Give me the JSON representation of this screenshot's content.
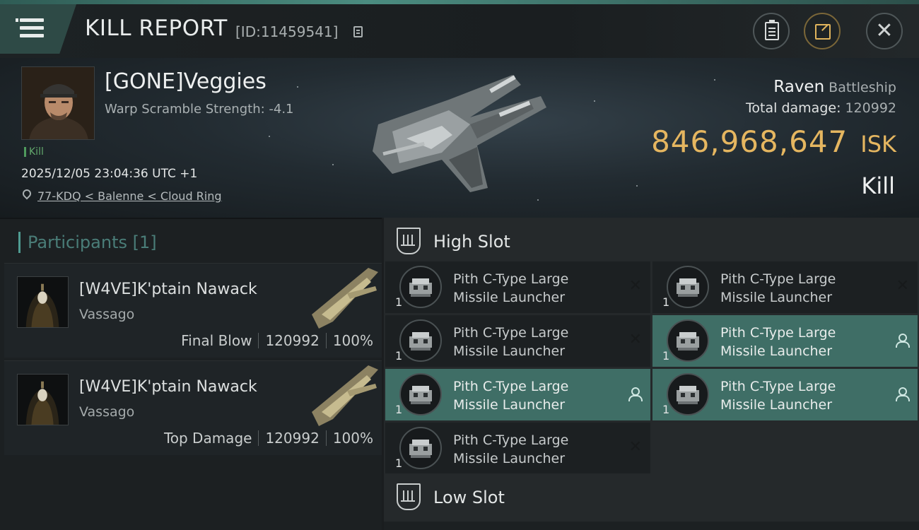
{
  "titlebar": {
    "title": "KILL REPORT",
    "report_id": "[ID:11459541]"
  },
  "victim": {
    "name": "[GONE]Veggies",
    "warp_scramble": "Warp Scramble Strength: -4.1",
    "kill_tag": "Kill",
    "timestamp": "2025/12/05 23:04:36 UTC +1",
    "location": "77-KDQ < Balenne < Cloud Ring",
    "ship_name": "Raven",
    "ship_class": "Battleship",
    "total_damage_label": "Total damage:",
    "total_damage_value": "120992",
    "isk_value": "846,968,647",
    "isk_unit": "ISK",
    "kill_type": "Kill"
  },
  "participants": {
    "label": "Participants",
    "count": "[1]",
    "rows": [
      {
        "name": "[W4VE]K'ptain Nawack",
        "ship": "Vassago",
        "role": "Final Blow",
        "damage": "120992",
        "percent": "100%"
      },
      {
        "name": "[W4VE]K'ptain Nawack",
        "ship": "Vassago",
        "role": "Top Damage",
        "damage": "120992",
        "percent": "100%"
      }
    ]
  },
  "modules": {
    "high_slot_label": "High Slot",
    "low_slot_label": "Low Slot",
    "high_items": [
      {
        "line1": "Pith C-Type Large",
        "line2": "Missile Launcher",
        "qty": "1",
        "status": "destroyed"
      },
      {
        "line1": "Pith C-Type Large",
        "line2": "Missile Launcher",
        "qty": "1",
        "status": "destroyed"
      },
      {
        "line1": "Pith C-Type Large",
        "line2": "Missile Launcher",
        "qty": "1",
        "status": "destroyed"
      },
      {
        "line1": "Pith C-Type Large",
        "line2": "Missile Launcher",
        "qty": "1",
        "status": "dropped"
      },
      {
        "line1": "Pith C-Type Large",
        "line2": "Missile Launcher",
        "qty": "1",
        "status": "dropped"
      },
      {
        "line1": "Pith C-Type Large",
        "line2": "Missile Launcher",
        "qty": "1",
        "status": "dropped"
      },
      {
        "line1": "Pith C-Type Large",
        "line2": "Missile Launcher",
        "qty": "1",
        "status": "destroyed"
      }
    ]
  },
  "colors": {
    "accent": "#4f9c92",
    "highlight_row": "#3f6e66",
    "isk_gold": "#e5b660",
    "kill_green": "#62a86c"
  },
  "icons": [
    "menu-icon",
    "copy-icon",
    "clipboard-icon",
    "share-icon",
    "close-icon",
    "location-pin-icon",
    "high-slot-icon",
    "low-slot-icon",
    "destroyed-x-icon",
    "dropped-user-icon"
  ]
}
